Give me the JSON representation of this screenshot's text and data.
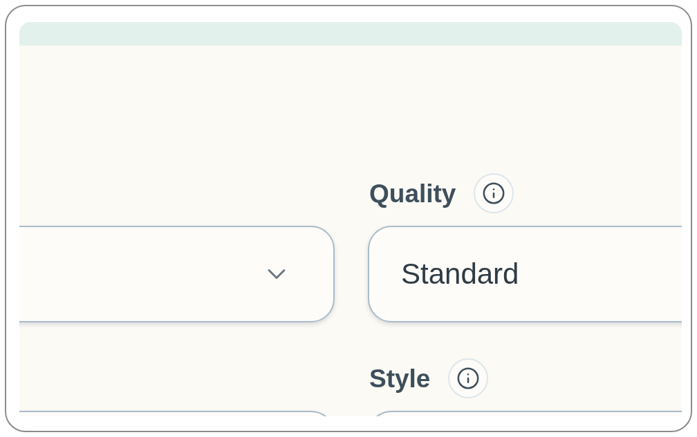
{
  "left_fields": [
    {
      "kind": "dropdown"
    },
    {
      "kind": "plain"
    }
  ],
  "right_fields": [
    {
      "label": "Quality",
      "value": "Standard"
    },
    {
      "label": "Style"
    }
  ]
}
